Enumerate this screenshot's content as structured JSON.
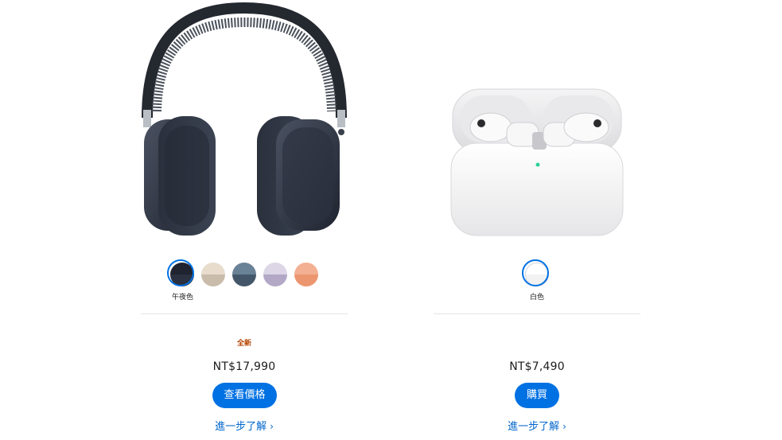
{
  "products": [
    {
      "id": "airpods-max",
      "colors": [
        {
          "name": "午夜色",
          "top": "#1f2430",
          "bottom": "#2b3140",
          "selected": true
        },
        {
          "name": "星光色",
          "top": "#e8dccd",
          "bottom": "#c9bcaa",
          "selected": false
        },
        {
          "name": "藍色",
          "top": "#6a8296",
          "bottom": "#44576a",
          "selected": false
        },
        {
          "name": "紫色",
          "top": "#dcd6e6",
          "bottom": "#b3a8c6",
          "selected": false
        },
        {
          "name": "橙色",
          "top": "#f3b092",
          "bottom": "#ec9670",
          "selected": false
        }
      ],
      "selected_color_label": "午夜色",
      "badge": "全新",
      "price": "NT$17,990",
      "cta_label": "查看價格",
      "learn_more": "進一步了解",
      "learn_more_chevron": "›"
    },
    {
      "id": "airpods-pro",
      "colors": [
        {
          "name": "白色",
          "top": "#ffffff",
          "bottom": "#f2f2f2",
          "selected": true
        }
      ],
      "selected_color_label": "白色",
      "price": "NT$7,490",
      "cta_label": "購買",
      "learn_more": "進一步了解",
      "learn_more_chevron": "›"
    }
  ]
}
